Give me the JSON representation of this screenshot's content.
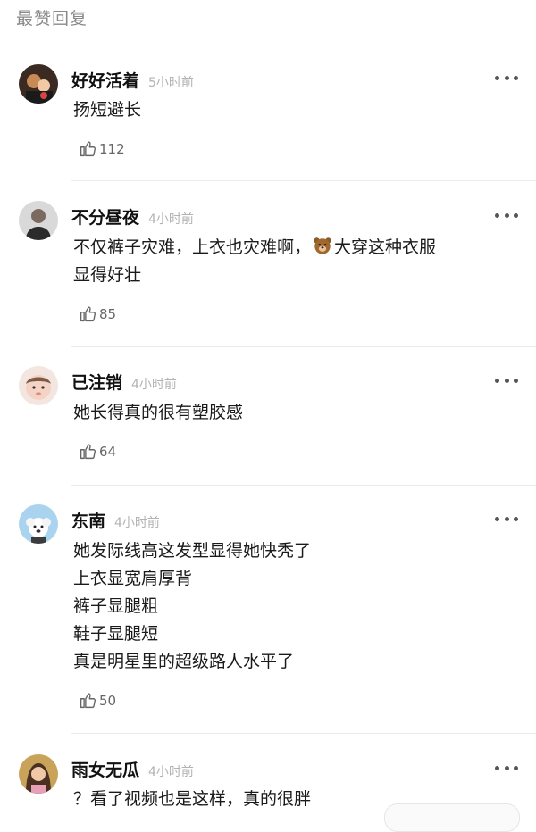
{
  "section_title": "最赞回复",
  "comments": [
    {
      "name": "好好活着",
      "time": "5小时前",
      "lines": [
        "扬短避长"
      ],
      "likes": "112",
      "avatar": "avatar-couple"
    },
    {
      "name": "不分昼夜",
      "time": "4小时前",
      "lines": [
        "不仅裤子灾难，上衣也灾难啊，",
        "大穿这种衣服",
        "显得好壮"
      ],
      "likes": "85",
      "avatar": "avatar-man",
      "emoji": "bear-emoji"
    },
    {
      "name": "已注销",
      "time": "4小时前",
      "lines": [
        "她长得真的很有塑胶感"
      ],
      "likes": "64",
      "avatar": "avatar-baby"
    },
    {
      "name": "东南",
      "time": "4小时前",
      "lines": [
        "她发际线高这发型显得她快秃了",
        "上衣显宽肩厚背",
        "裤子显腿粗",
        "鞋子显腿短",
        "真是明星里的超级路人水平了"
      ],
      "likes": "50",
      "avatar": "avatar-dog"
    },
    {
      "name": "雨女无瓜",
      "time": "4小时前",
      "lines": [
        "？看了视频也是这样，真的很胖"
      ],
      "likes": "",
      "avatar": "avatar-girl"
    }
  ],
  "colors": {
    "name": "#111111",
    "time": "#b3b3b3",
    "section_title": "#888888",
    "divider": "#ececec"
  }
}
